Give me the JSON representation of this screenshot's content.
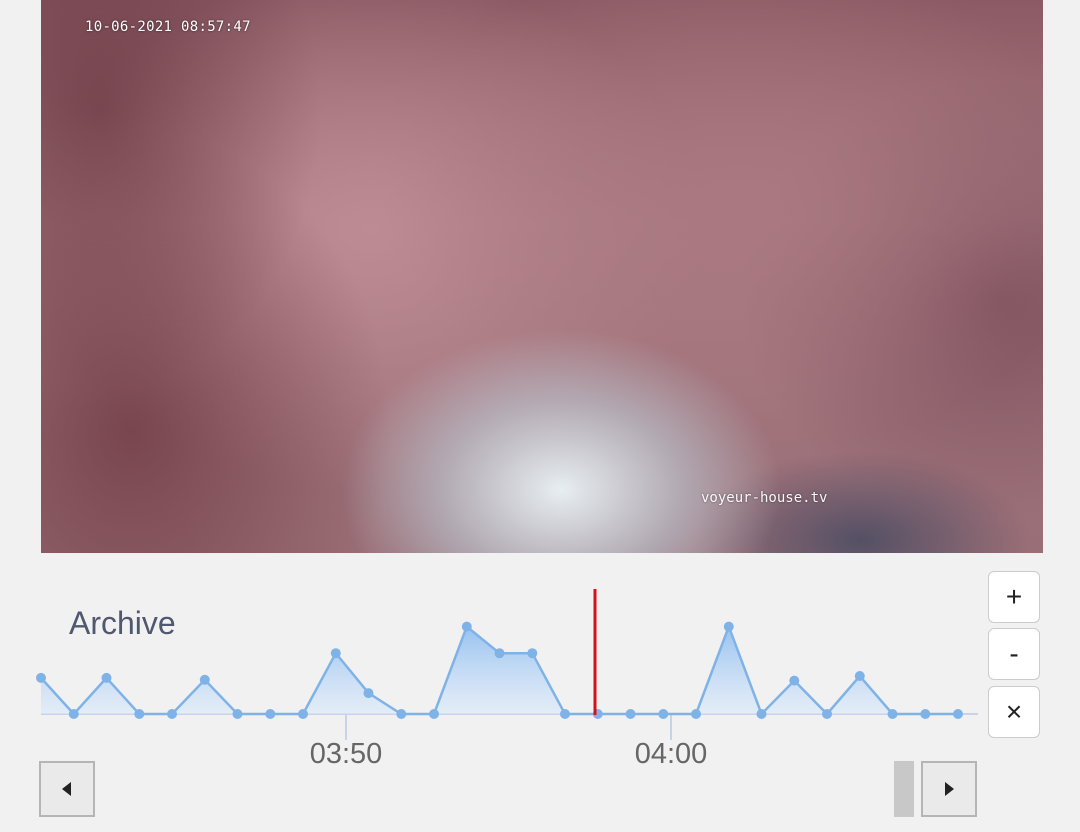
{
  "video": {
    "timestamp": "10-06-2021 08:57:47",
    "watermark": "voyeur-house.tv"
  },
  "archive": {
    "label": "Archive",
    "ticks": [
      "03:50",
      "04:00"
    ]
  },
  "controls": {
    "zoom_in": "+",
    "zoom_out": "-",
    "close": "×"
  },
  "colors": {
    "line": "#7fb3e8",
    "cursor": "#d0131b",
    "axis": "#c9d3e8"
  },
  "icons": {
    "prev": "triangle-left-icon",
    "next": "triangle-right-icon"
  },
  "activity_levels": [
    0.95,
    0,
    0.95,
    0,
    0,
    0.9,
    0,
    0,
    0,
    1.6,
    0.55,
    0,
    0,
    2.3,
    1.6,
    1.6,
    0,
    0,
    0,
    0,
    0,
    2.3,
    0,
    0.88,
    0,
    1.0,
    0,
    0,
    0
  ]
}
